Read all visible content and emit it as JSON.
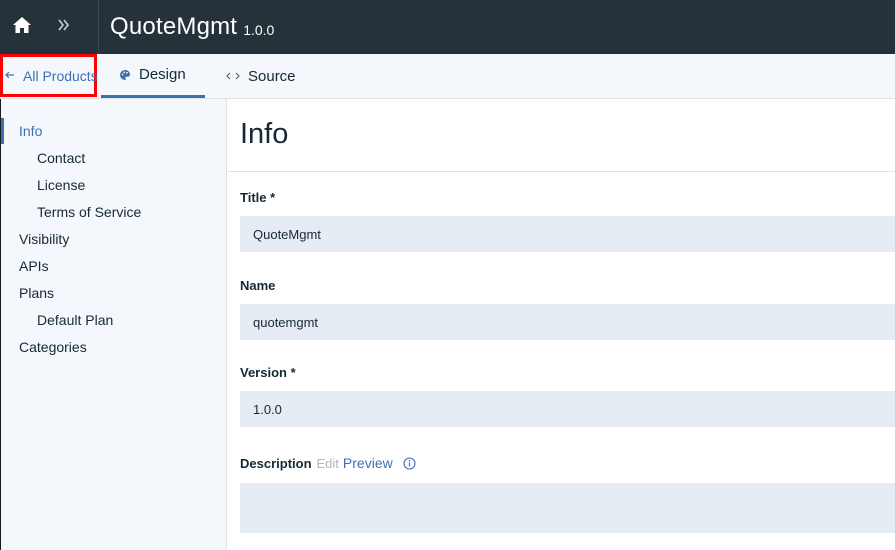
{
  "header": {
    "title": "QuoteMgmt",
    "version": "1.0.0",
    "home_icon": "home-icon",
    "expand_icon": "chevron-double-right-icon"
  },
  "tabs": {
    "back_label": "All Products",
    "back_icon": "arrow-left-icon",
    "items": [
      {
        "label": "Design",
        "icon": "palette-icon",
        "active": true
      },
      {
        "label": "Source",
        "icon": "code-icon",
        "active": false
      }
    ]
  },
  "sidebar": {
    "items": [
      {
        "label": "Info",
        "level": 0,
        "active": true
      },
      {
        "label": "Contact",
        "level": 1
      },
      {
        "label": "License",
        "level": 1
      },
      {
        "label": "Terms of Service",
        "level": 1
      },
      {
        "label": "Visibility",
        "level": 0
      },
      {
        "label": "APIs",
        "level": 0
      },
      {
        "label": "Plans",
        "level": 0
      },
      {
        "label": "Default Plan",
        "level": 1
      },
      {
        "label": "Categories",
        "level": 0
      }
    ]
  },
  "main": {
    "title": "Info",
    "fields": {
      "title": {
        "label": "Title *",
        "value": "QuoteMgmt"
      },
      "name": {
        "label": "Name",
        "value": "quotemgmt"
      },
      "version": {
        "label": "Version *",
        "value": "1.0.0"
      }
    },
    "description": {
      "label": "Description",
      "edit_label": "Edit",
      "preview_label": "Preview",
      "value": ""
    }
  },
  "colors": {
    "header_bg": "#26323a",
    "accent": "#3d70b2",
    "input_bg": "#e6ecf4",
    "highlight_box": "#ff0000"
  }
}
